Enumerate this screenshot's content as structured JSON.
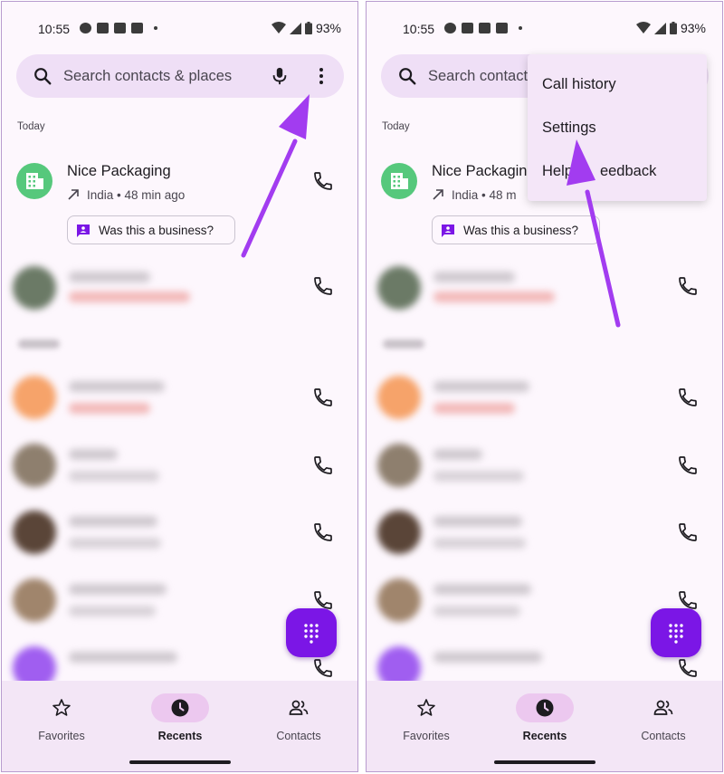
{
  "status_bar": {
    "time": "10:55",
    "battery": "93%"
  },
  "search": {
    "placeholder": "Search contacts & places",
    "placeholder_short": "Search contact"
  },
  "recents": {
    "section_today": "Today",
    "entries": [
      {
        "name": "Nice Packaging",
        "name_short": "Nice Packaging",
        "detail": "India • 48 min ago",
        "detail_short": "India • 48 m",
        "chip_label": "Was this a business?"
      }
    ]
  },
  "overflow_menu": {
    "items": [
      "Call history",
      "Settings",
      "Help & feedback"
    ],
    "help_visible": "Help",
    "feedback_visible": "eedback"
  },
  "bottom_nav": {
    "items": [
      {
        "label": "Favorites",
        "icon": "star-icon"
      },
      {
        "label": "Recents",
        "icon": "clock-icon",
        "active": true
      },
      {
        "label": "Contacts",
        "icon": "people-icon"
      }
    ]
  },
  "colors": {
    "accent": "#7b16e6",
    "arrow": "#a23cf0",
    "business_avatar": "#56c87c",
    "search_bar": "#efdff6"
  }
}
